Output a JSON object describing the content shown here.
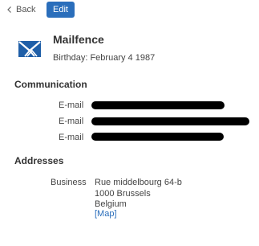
{
  "toolbar": {
    "back_label": "Back",
    "edit_label": "Edit"
  },
  "contact": {
    "name": "Mailfence",
    "birthday": "Birthday: February 4 1987"
  },
  "communication": {
    "title": "Communication",
    "entries": [
      {
        "label": "E-mail",
        "redacted": true
      },
      {
        "label": "E-mail",
        "redacted": true
      },
      {
        "label": "E-mail",
        "redacted": true
      }
    ]
  },
  "addresses": {
    "title": "Addresses",
    "business": {
      "label": "Business",
      "lines": [
        "Rue middelbourg 64-b",
        "1000 Brussels",
        "Belgium"
      ],
      "map_link": "[Map]"
    }
  },
  "colors": {
    "accent": "#2a6ebb",
    "logo": "#1f5fa8",
    "redaction": "#000000"
  }
}
